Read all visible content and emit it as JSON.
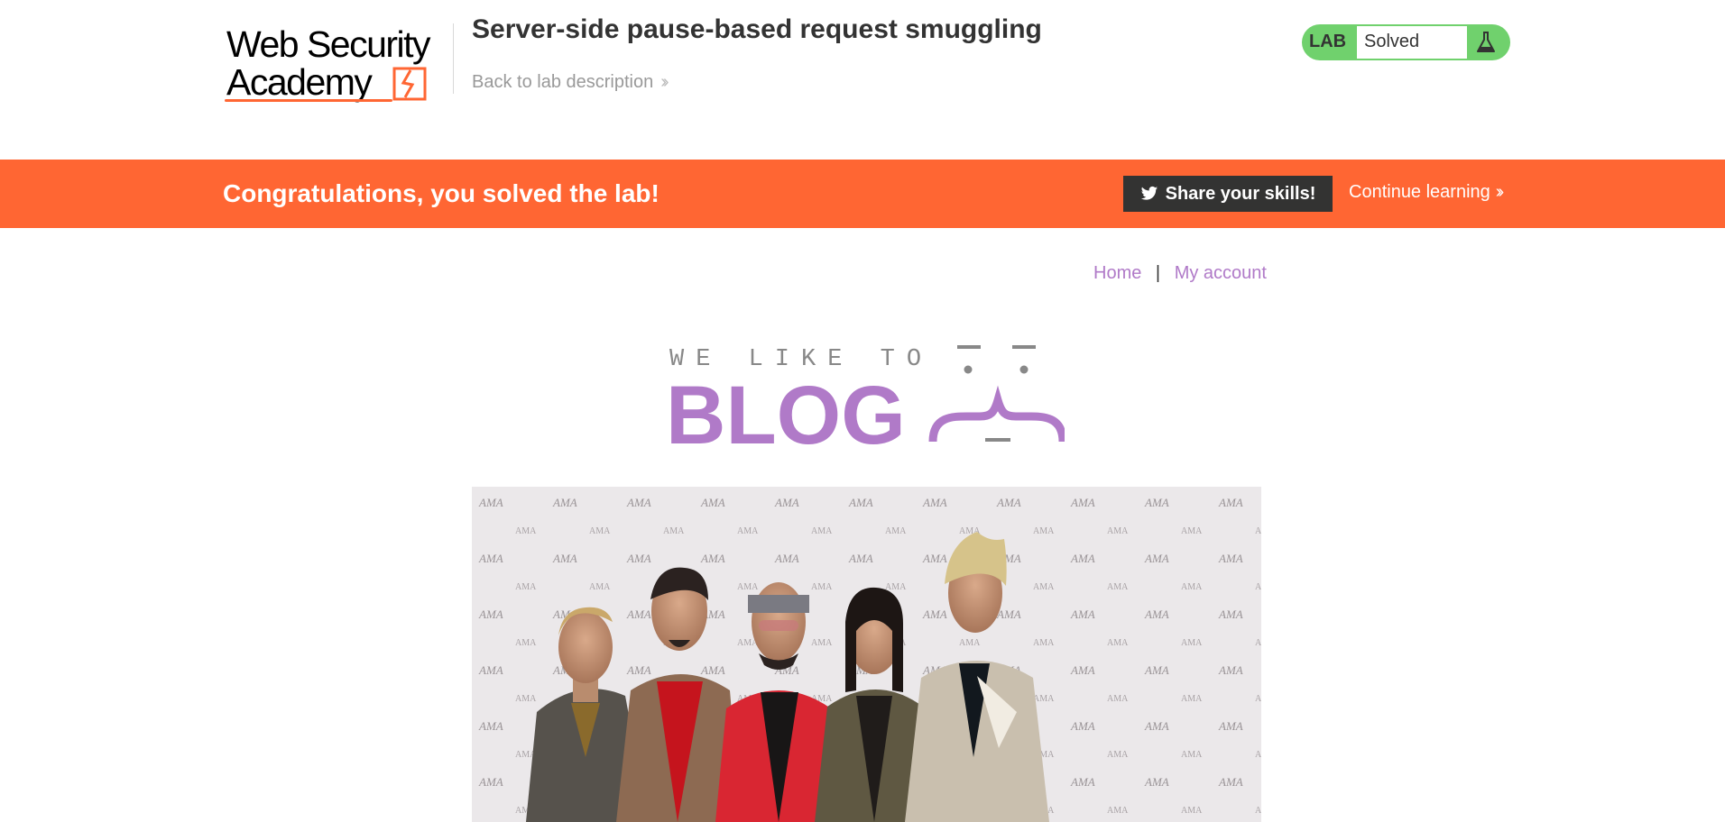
{
  "header": {
    "logo_line1": "Web Security",
    "logo_line2": "Academy",
    "lab_title": "Server-side pause-based request smuggling",
    "back_link": "Back to lab description",
    "lab_status_label": "LAB",
    "lab_status_value": "Solved"
  },
  "banner": {
    "message": "Congratulations, you solved the lab!",
    "share_label": "Share your skills!",
    "continue_label": "Continue learning"
  },
  "nav": {
    "home": "Home",
    "separator": "|",
    "account": "My account"
  },
  "blog_logo": {
    "tagline": "WE LIKE TO",
    "word": "BLOG"
  },
  "colors": {
    "accent_orange": "#ff6633",
    "status_green": "#70d16d",
    "link_purple": "#b07ac8",
    "dark_button": "#333332"
  },
  "icons": {
    "back_chevron": "double-chevron-right-icon",
    "flask": "flask-icon",
    "twitter": "twitter-icon",
    "continue_chevron": "double-chevron-right-icon"
  }
}
